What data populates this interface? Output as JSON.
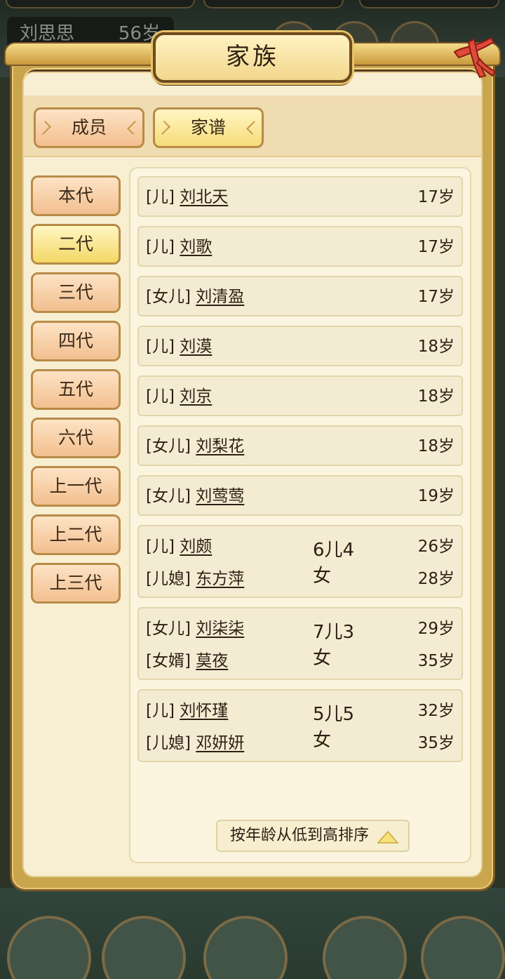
{
  "background": {
    "player_name": "刘思思",
    "player_age": "56岁"
  },
  "modal": {
    "title": "家族"
  },
  "tabs": [
    {
      "label": "成员",
      "active": false
    },
    {
      "label": "家谱",
      "active": true
    }
  ],
  "generations": [
    {
      "label": "本代",
      "active": false
    },
    {
      "label": "二代",
      "active": true
    },
    {
      "label": "三代",
      "active": false
    },
    {
      "label": "四代",
      "active": false
    },
    {
      "label": "五代",
      "active": false
    },
    {
      "label": "六代",
      "active": false
    },
    {
      "label": "上一代",
      "active": false
    },
    {
      "label": "上二代",
      "active": false
    },
    {
      "label": "上三代",
      "active": false
    }
  ],
  "members": [
    {
      "relation": "[儿]",
      "name": "刘北天",
      "age": "17岁"
    },
    {
      "relation": "[儿]",
      "name": "刘歌",
      "age": "17岁"
    },
    {
      "relation": "[女儿]",
      "name": "刘清盈",
      "age": "17岁"
    },
    {
      "relation": "[儿]",
      "name": "刘漠",
      "age": "18岁"
    },
    {
      "relation": "[儿]",
      "name": "刘京",
      "age": "18岁"
    },
    {
      "relation": "[女儿]",
      "name": "刘梨花",
      "age": "18岁"
    },
    {
      "relation": "[女儿]",
      "name": "刘莺莺",
      "age": "19岁"
    }
  ],
  "couples": [
    {
      "relation": "[儿]",
      "name": "刘颇",
      "age": "26岁",
      "spouse_relation": "[儿媳]",
      "spouse_name": "东方萍",
      "spouse_age": "28岁",
      "children": "6儿4女"
    },
    {
      "relation": "[女儿]",
      "name": "刘柒柒",
      "age": "29岁",
      "spouse_relation": "[女婿]",
      "spouse_name": "莫夜",
      "spouse_age": "35岁",
      "children": "7儿3女"
    },
    {
      "relation": "[儿]",
      "name": "刘怀瑾",
      "age": "32岁",
      "spouse_relation": "[儿媳]",
      "spouse_name": "邓妍妍",
      "spouse_age": "35岁",
      "children": "5儿5女"
    }
  ],
  "sort": {
    "label": "按年龄从低到高排序",
    "icon": "triangle-up-icon"
  },
  "colors": {
    "frame_gold": "#c9a64e",
    "panel_cream": "#f8efd3",
    "active_tab": "#f6dc7a",
    "inactive_tab": "#f2bf8f",
    "close_red": "#e04a3a"
  }
}
